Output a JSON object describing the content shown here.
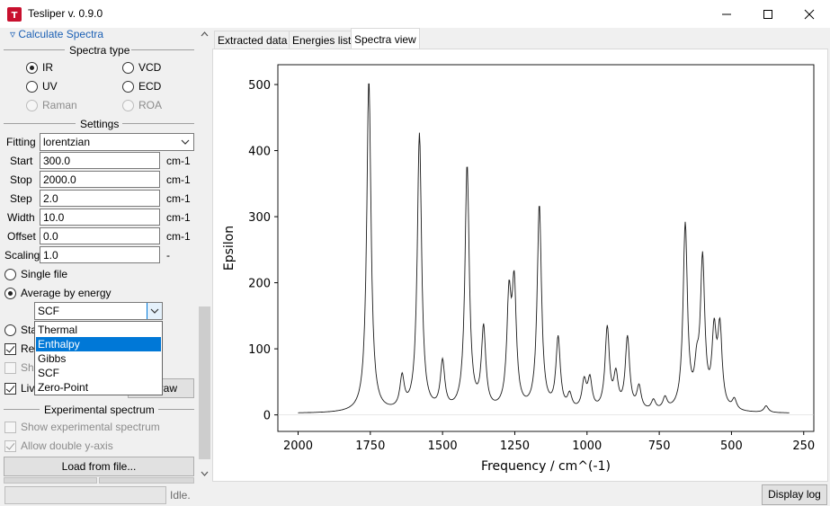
{
  "window": {
    "title": "Tesliper v. 0.9.0",
    "controls": [
      "minimize",
      "maximize",
      "close"
    ]
  },
  "left_panel": {
    "section_toggle": "▿ Calculate Spectra",
    "spectra_type": {
      "title": "Spectra type",
      "options": [
        {
          "label": "IR",
          "checked": true,
          "disabled": false
        },
        {
          "label": "VCD",
          "checked": false,
          "disabled": false
        },
        {
          "label": "UV",
          "checked": false,
          "disabled": false
        },
        {
          "label": "ECD",
          "checked": false,
          "disabled": false
        },
        {
          "label": "Raman",
          "checked": false,
          "disabled": true
        },
        {
          "label": "ROA",
          "checked": false,
          "disabled": true
        }
      ]
    },
    "settings": {
      "title": "Settings",
      "fitting_label": "Fitting",
      "fitting_value": "lorentzian",
      "rows": [
        {
          "label": "Start",
          "value": "300.0",
          "unit": "cm-1"
        },
        {
          "label": "Stop",
          "value": "2000.0",
          "unit": "cm-1"
        },
        {
          "label": "Step",
          "value": "2.0",
          "unit": "cm-1"
        },
        {
          "label": "Width",
          "value": "10.0",
          "unit": "cm-1"
        },
        {
          "label": "Offset",
          "value": "0.0",
          "unit": "cm-1"
        },
        {
          "label": "Scaling",
          "value": "1.0",
          "unit": "-"
        }
      ]
    },
    "mode": {
      "single_file": "Single file",
      "average_by_energy": "Average by energy",
      "energy_selected": "SCF",
      "stack_partial": "Sta",
      "reverse_partial": "Re",
      "show_partial": "Sho",
      "live_partial": "Liv",
      "redraw_partial": "raw"
    },
    "dropdown": {
      "options": [
        "Thermal",
        "Enthalpy",
        "Gibbs",
        "SCF",
        "Zero-Point"
      ],
      "highlighted": "Enthalpy"
    },
    "experimental": {
      "title": "Experimental spectrum",
      "show_experimental": "Show experimental spectrum",
      "allow_double": "Allow double y-axis",
      "load_button": "Load from file..."
    }
  },
  "tabs": [
    {
      "label": "Extracted data",
      "active": false
    },
    {
      "label": "Energies list",
      "active": false
    },
    {
      "label": "Spectra view",
      "active": true
    }
  ],
  "status": {
    "text": "Idle.",
    "log_button": "Display log"
  },
  "colors": {
    "accent": "#0078d7",
    "link": "#1a5fb4",
    "background": "#f0f0f0"
  },
  "chart_data": {
    "type": "line",
    "xlabel": "Frequency / cm^(-1)",
    "ylabel": "Epsilon",
    "xlim": [
      2070,
      215
    ],
    "ylim": [
      -25,
      530
    ],
    "x_reversed": true,
    "xticks": [
      2000,
      1750,
      1500,
      1250,
      1000,
      750,
      500,
      250
    ],
    "yticks": [
      0,
      100,
      200,
      300,
      400,
      500
    ],
    "grid": false,
    "line_color": "#1a1a1a",
    "peaks": [
      {
        "x": 1755,
        "y": 503
      },
      {
        "x": 1640,
        "y": 48
      },
      {
        "x": 1580,
        "y": 420
      },
      {
        "x": 1500,
        "y": 72
      },
      {
        "x": 1415,
        "y": 370
      },
      {
        "x": 1358,
        "y": 122
      },
      {
        "x": 1270,
        "y": 160
      },
      {
        "x": 1252,
        "y": 178
      },
      {
        "x": 1165,
        "y": 310
      },
      {
        "x": 1100,
        "y": 108
      },
      {
        "x": 1060,
        "y": 22
      },
      {
        "x": 1010,
        "y": 42
      },
      {
        "x": 990,
        "y": 45
      },
      {
        "x": 930,
        "y": 124
      },
      {
        "x": 900,
        "y": 50
      },
      {
        "x": 860,
        "y": 110
      },
      {
        "x": 820,
        "y": 35
      },
      {
        "x": 770,
        "y": 15
      },
      {
        "x": 730,
        "y": 18
      },
      {
        "x": 660,
        "y": 280
      },
      {
        "x": 620,
        "y": 50
      },
      {
        "x": 600,
        "y": 222
      },
      {
        "x": 560,
        "y": 110
      },
      {
        "x": 540,
        "y": 118
      },
      {
        "x": 490,
        "y": 16
      },
      {
        "x": 380,
        "y": 10
      }
    ]
  }
}
